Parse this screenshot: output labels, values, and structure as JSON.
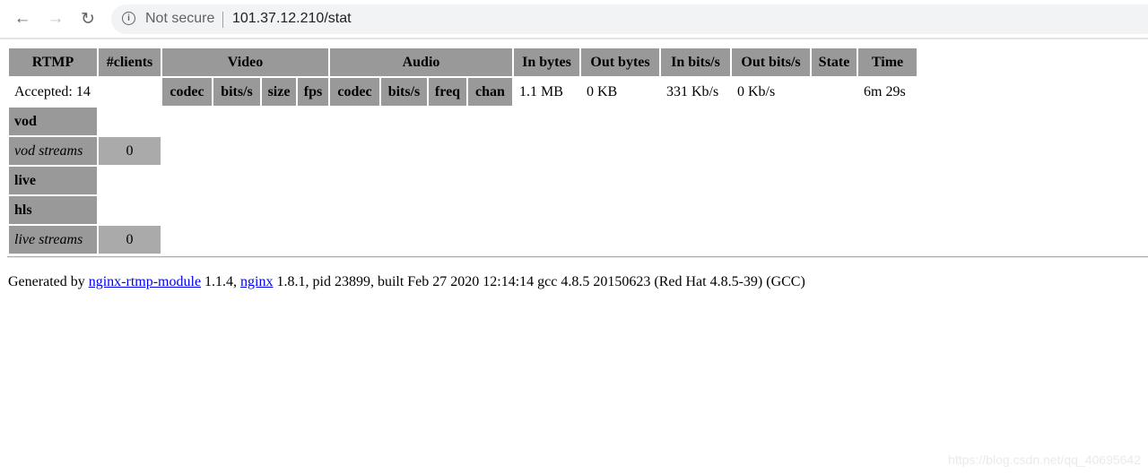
{
  "browser": {
    "security": "Not secure",
    "url": "101.37.12.210/stat",
    "icons": [
      "back-arrow",
      "forward-arrow",
      "reload",
      "info"
    ]
  },
  "table": {
    "headers": [
      "RTMP",
      "#clients",
      "Video",
      "Audio",
      "In bytes",
      "Out bytes",
      "In bits/s",
      "Out bits/s",
      "State",
      "Time"
    ],
    "video_sub": [
      "codec",
      "bits/s",
      "size",
      "fps"
    ],
    "audio_sub": [
      "codec",
      "bits/s",
      "freq",
      "chan"
    ],
    "summary": {
      "accepted": "Accepted: 14",
      "in_bytes": "1.1 MB",
      "out_bytes": "0 KB",
      "in_bits": "331 Kb/s",
      "out_bits": "0 Kb/s",
      "time": "6m 29s"
    },
    "apps": [
      {
        "name": "vod",
        "streams_label": "vod streams",
        "streams_count": "0"
      },
      {
        "name": "live",
        "hls": "hls",
        "streams_label": "live streams",
        "streams_count": "0"
      }
    ]
  },
  "footer": {
    "prefix": "Generated by ",
    "link1": "nginx-rtmp-module",
    "mid": " 1.1.4, ",
    "link2": "nginx",
    "suffix": " 1.8.1, pid 23899, built Feb 27 2020 12:14:14 gcc 4.8.5 20150623 (Red Hat 4.8.5-39) (GCC)"
  },
  "watermark": "https://blog.csdn.net/qq_40695642"
}
